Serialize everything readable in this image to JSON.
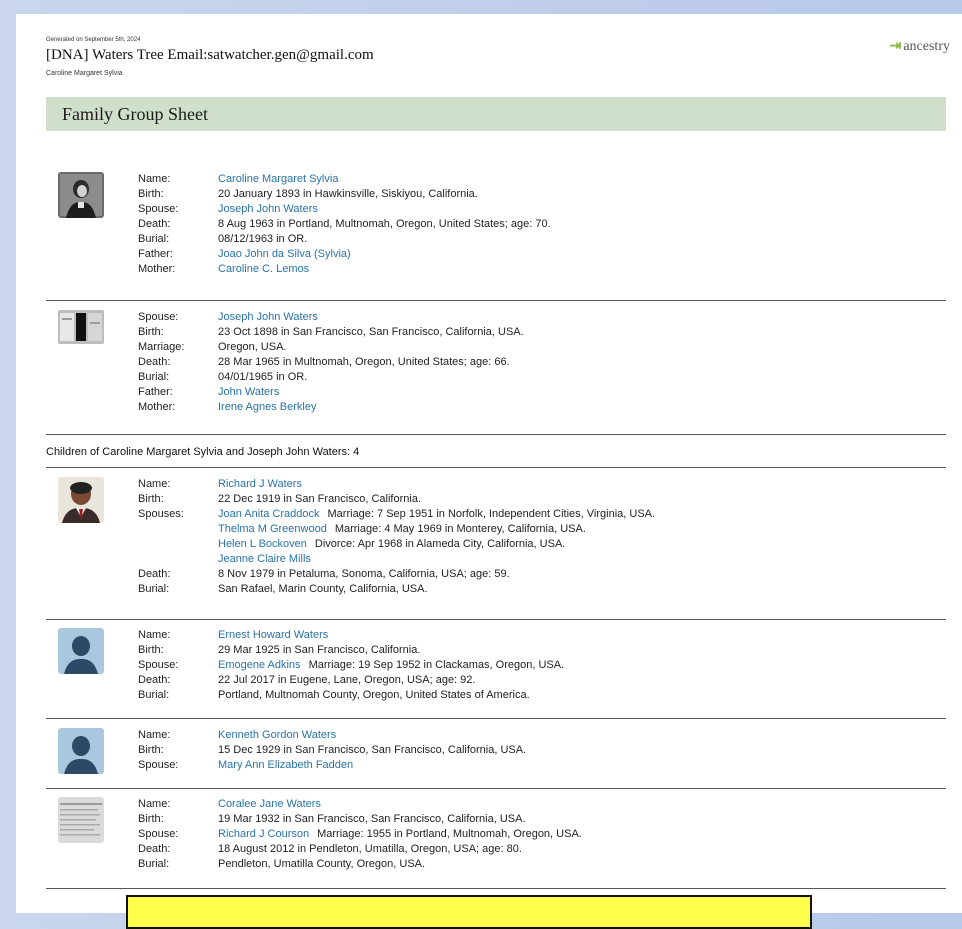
{
  "header": {
    "generated": "Generated on September 5th, 2024",
    "tree": "[DNA] Waters Tree Email:satwatcher.gen@gmail.com",
    "person": "Caroline Margaret Sylvia",
    "logo_text": "ancestry"
  },
  "banner": {
    "title": "Family Group Sheet"
  },
  "mother": {
    "rows": [
      {
        "label": "Name:",
        "value": "Caroline Margaret Sylvia",
        "link": true
      },
      {
        "label": "Birth:",
        "value": "20 January 1893 in Hawkinsville, Siskiyou, California."
      },
      {
        "label": "Spouse:",
        "value": "Joseph John Waters",
        "link": true
      },
      {
        "label": "Death:",
        "value": "8 Aug 1963 in Portland, Multnomah, Oregon, United States; age: 70."
      },
      {
        "label": "Burial:",
        "value": "08/12/1963 in OR."
      },
      {
        "label": "Father:",
        "value": "Joao John da Silva (Sylvia)",
        "link": true
      },
      {
        "label": "Mother:",
        "value": "Caroline C. Lemos",
        "link": true
      }
    ]
  },
  "father": {
    "rows": [
      {
        "label": "Spouse:",
        "value": "Joseph John Waters",
        "link": true
      },
      {
        "label": "Birth:",
        "value": "23 Oct 1898 in San Francisco, San Francisco, California, USA."
      },
      {
        "label": "Marriage:",
        "value": "Oregon, USA."
      },
      {
        "label": "Death:",
        "value": "28 Mar 1965 in Multnomah, Oregon, United States; age: 66."
      },
      {
        "label": "Burial:",
        "value": "04/01/1965 in OR."
      },
      {
        "label": "Father:",
        "value": "John Waters",
        "link": true
      },
      {
        "label": "Mother:",
        "value": "Irene Agnes Berkley",
        "link": true
      }
    ]
  },
  "children_header": "Children of Caroline Margaret Sylvia and Joseph John Waters: 4",
  "children": [
    {
      "rows": [
        {
          "label": "Name:",
          "link_text": "Richard J Waters"
        },
        {
          "label": "Birth:",
          "text": "22 Dec 1919 in San Francisco, California."
        },
        {
          "label": "Spouses:",
          "link_text": "Joan Anita Craddock",
          "text": "Marriage: 7 Sep 1951 in Norfolk, Independent Cities, Virginia, USA."
        },
        {
          "label": "",
          "link_text": "Thelma M Greenwood",
          "text": "Marriage: 4 May 1969 in Monterey, California, USA."
        },
        {
          "label": "",
          "link_text": "Helen L Bockoven",
          "text": "Divorce: Apr 1968 in Alameda City, California, USA."
        },
        {
          "label": "",
          "link_text": "Jeanne Claire Mills"
        },
        {
          "label": "Death:",
          "text": "8 Nov 1979 in Petaluma, Sonoma, California, USA; age: 59."
        },
        {
          "label": "Burial:",
          "text": "San Rafael, Marin County, California, USA."
        }
      ]
    },
    {
      "rows": [
        {
          "label": "Name:",
          "link_text": "Ernest Howard Waters"
        },
        {
          "label": "Birth:",
          "text": "29 Mar 1925 in San Francisco, California."
        },
        {
          "label": "Spouse:",
          "link_text": "Emogene Adkins",
          "text": "Marriage: 19 Sep 1952 in Clackamas, Oregon, USA."
        },
        {
          "label": "Death:",
          "text": "22 Jul 2017 in Eugene, Lane, Oregon, USA; age: 92."
        },
        {
          "label": "Burial:",
          "text": "Portland, Multnomah County, Oregon, United States of America."
        }
      ]
    },
    {
      "rows": [
        {
          "label": "Name:",
          "link_text": "Kenneth Gordon Waters"
        },
        {
          "label": "Birth:",
          "text": "15 Dec 1929 in San Francisco, San Francisco, California, USA."
        },
        {
          "label": "Spouse:",
          "link_text": "Mary Ann Elizabeth Fadden"
        }
      ]
    },
    {
      "rows": [
        {
          "label": "Name:",
          "link_text": "Coralee Jane Waters"
        },
        {
          "label": "Birth:",
          "text": "19 Mar 1932 in San Francisco, San Francisco, California, USA."
        },
        {
          "label": "Spouse:",
          "link_text": "Richard J Courson",
          "text": "Marriage: 1955 in Portland, Multnomah, Oregon, USA."
        },
        {
          "label": "Death:",
          "text": "18 August 2012 in Pendleton, Umatilla, Oregon, USA; age: 80."
        },
        {
          "label": "Burial:",
          "text": "Pendleton, Umatilla County, Oregon, USA."
        }
      ]
    }
  ],
  "colors": {
    "banner": "#cfdfc9",
    "link": "#2a73a8",
    "highlight": "#ffff4a"
  }
}
